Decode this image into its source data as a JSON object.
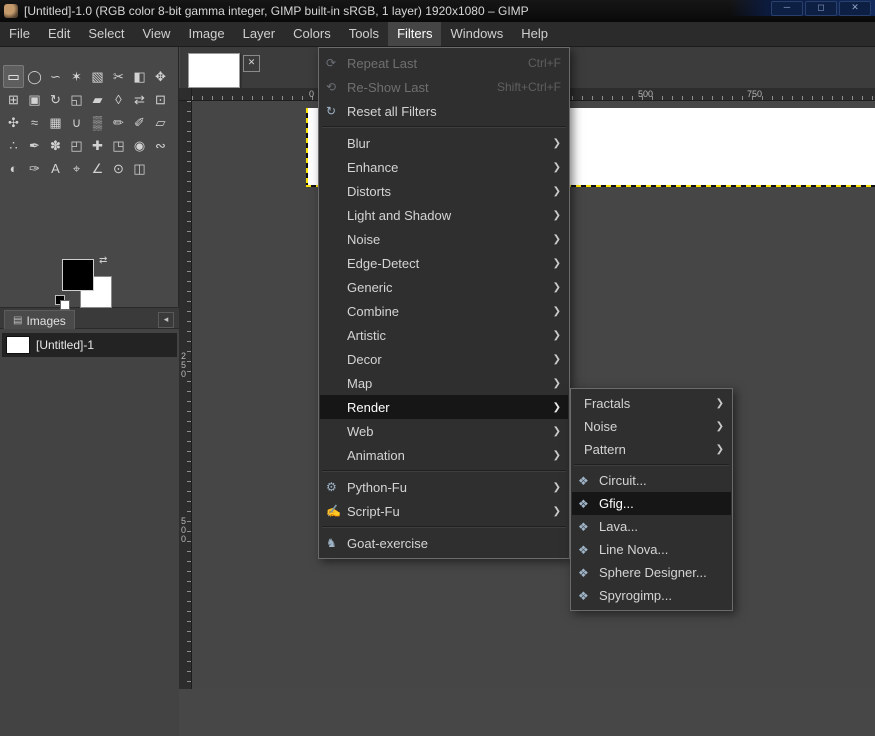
{
  "titlebar": {
    "title": "[Untitled]-1.0 (RGB color 8-bit gamma integer, GIMP built-in sRGB, 1 layer) 1920x1080 – GIMP"
  },
  "menubar": {
    "items": [
      "File",
      "Edit",
      "Select",
      "View",
      "Image",
      "Layer",
      "Colors",
      "Tools",
      "Filters",
      "Windows",
      "Help"
    ],
    "active": "Filters"
  },
  "toolbox": {
    "tools": [
      {
        "name": "rectangle-select",
        "glyph": "▭",
        "active": true
      },
      {
        "name": "ellipse-select",
        "glyph": "◯"
      },
      {
        "name": "free-select",
        "glyph": "∽"
      },
      {
        "name": "fuzzy-select",
        "glyph": "✶"
      },
      {
        "name": "select-by-color",
        "glyph": "▧"
      },
      {
        "name": "scissors-select",
        "glyph": "✂"
      },
      {
        "name": "foreground-select",
        "glyph": "◧"
      },
      {
        "name": "move",
        "glyph": "✥"
      },
      {
        "name": "alignment",
        "glyph": "⊞"
      },
      {
        "name": "crop",
        "glyph": "▣"
      },
      {
        "name": "rotate",
        "glyph": "↻"
      },
      {
        "name": "scale",
        "glyph": "◱"
      },
      {
        "name": "shear",
        "glyph": "▰"
      },
      {
        "name": "perspective",
        "glyph": "◊"
      },
      {
        "name": "flip",
        "glyph": "⇄"
      },
      {
        "name": "unified-transform",
        "glyph": "⊡"
      },
      {
        "name": "handle-transform",
        "glyph": "✣"
      },
      {
        "name": "warp-transform",
        "glyph": "≈"
      },
      {
        "name": "cage-transform",
        "glyph": "▦"
      },
      {
        "name": "bucket-fill",
        "glyph": "∪"
      },
      {
        "name": "gradient",
        "glyph": "▒"
      },
      {
        "name": "pencil",
        "glyph": "✏"
      },
      {
        "name": "paintbrush",
        "glyph": "✐"
      },
      {
        "name": "eraser",
        "glyph": "▱"
      },
      {
        "name": "airbrush",
        "glyph": "∴"
      },
      {
        "name": "ink",
        "glyph": "✒"
      },
      {
        "name": "mypaint-brush",
        "glyph": "✽"
      },
      {
        "name": "clone",
        "glyph": "◰"
      },
      {
        "name": "heal",
        "glyph": "✚"
      },
      {
        "name": "perspective-clone",
        "glyph": "◳"
      },
      {
        "name": "blur-sharpen",
        "glyph": "◉"
      },
      {
        "name": "smudge",
        "glyph": "∾"
      },
      {
        "name": "dodge-burn",
        "glyph": "◐"
      },
      {
        "name": "paths",
        "glyph": "✑"
      },
      {
        "name": "text",
        "glyph": "A"
      },
      {
        "name": "color-picker",
        "glyph": "⌖"
      },
      {
        "name": "measure",
        "glyph": "∠"
      },
      {
        "name": "zoom",
        "glyph": "⊙"
      },
      {
        "name": "3d-transform",
        "glyph": "◫"
      }
    ],
    "foreground_color": "#000000",
    "background_color": "#ffffff"
  },
  "images_panel": {
    "tab_label": "Images",
    "rows": [
      {
        "label": "[Untitled]-1"
      }
    ]
  },
  "rulers": {
    "horizontal_labels": [
      "0",
      "500",
      "750"
    ],
    "vertical_labels": [
      "250",
      "500"
    ]
  },
  "filters_menu": {
    "items": [
      {
        "label": "Repeat Last",
        "shortcut": "Ctrl+F",
        "disabled": true
      },
      {
        "label": "Re-Show Last",
        "shortcut": "Shift+Ctrl+F",
        "disabled": true
      },
      {
        "label": "Reset all Filters"
      },
      {
        "label": "Blur",
        "submenu": true
      },
      {
        "label": "Enhance",
        "submenu": true
      },
      {
        "label": "Distorts",
        "submenu": true
      },
      {
        "label": "Light and Shadow",
        "submenu": true
      },
      {
        "label": "Noise",
        "submenu": true
      },
      {
        "label": "Edge-Detect",
        "submenu": true
      },
      {
        "label": "Generic",
        "submenu": true
      },
      {
        "label": "Combine",
        "submenu": true
      },
      {
        "label": "Artistic",
        "submenu": true
      },
      {
        "label": "Decor",
        "submenu": true
      },
      {
        "label": "Map",
        "submenu": true
      },
      {
        "label": "Render",
        "submenu": true,
        "highlighted": true
      },
      {
        "label": "Web",
        "submenu": true
      },
      {
        "label": "Animation",
        "submenu": true
      },
      {
        "label": "Python-Fu",
        "submenu": true
      },
      {
        "label": "Script-Fu",
        "submenu": true
      },
      {
        "label": "Goat-exercise"
      }
    ]
  },
  "render_submenu": {
    "items": [
      {
        "label": "Fractals",
        "submenu": true
      },
      {
        "label": "Noise",
        "submenu": true
      },
      {
        "label": "Pattern",
        "submenu": true
      },
      {
        "label": "Circuit..."
      },
      {
        "label": "Gfig...",
        "highlighted": true
      },
      {
        "label": "Lava..."
      },
      {
        "label": "Line Nova..."
      },
      {
        "label": "Sphere Designer..."
      },
      {
        "label": "Spyrogimp..."
      }
    ]
  },
  "icons": {
    "chevron": "❯",
    "repeat": "⟳",
    "reshow": "⟲",
    "reset": "↻",
    "python": "⚙",
    "script": "✍",
    "goat": "♞",
    "plugin": "❖",
    "close": "✕",
    "collapse": "◂",
    "swap": "⇄",
    "images_tab": "▤",
    "minimize": "─",
    "maximize": "◻",
    "window_close": "✕"
  },
  "colors": {
    "menu_highlight": "#161616",
    "canvas_white": "#ffffff",
    "layer_boundary_yellow": "#ffe400",
    "ui_background": "#474747"
  }
}
